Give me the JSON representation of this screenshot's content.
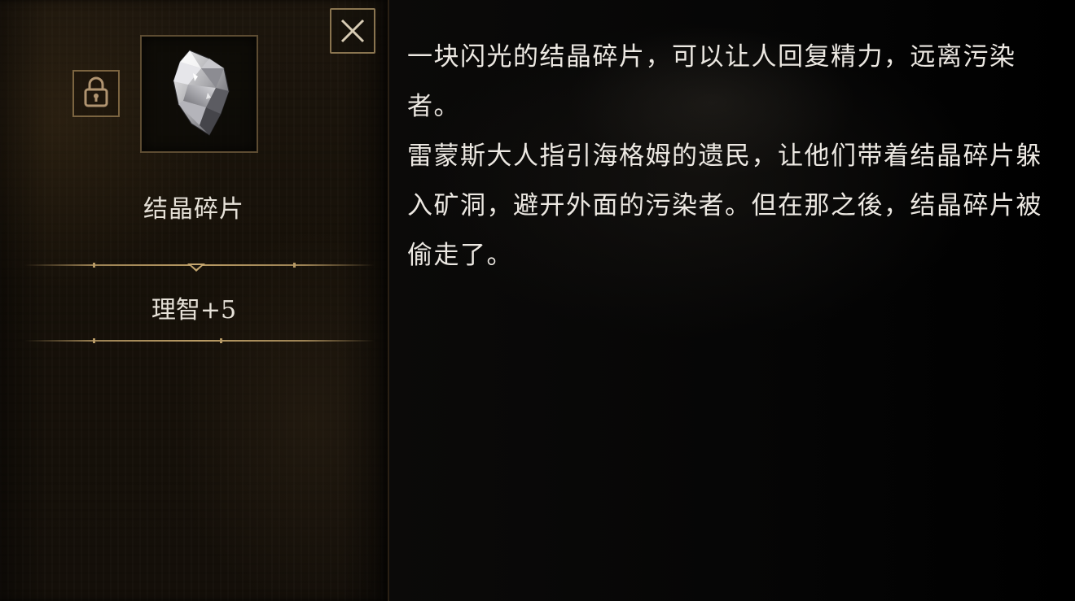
{
  "item": {
    "name": "结晶碎片",
    "stat": "理智+5",
    "icon": "crystal-shard-icon"
  },
  "controls": {
    "close_icon": "close-icon",
    "lock_icon": "lock-icon"
  },
  "description": {
    "paragraph_1": "一块闪光的结晶碎片，可以让人回复精力，远离污染者。",
    "paragraph_2": "雷蒙斯大人指引海格姆的遗民，让他们带着结晶碎片躲入矿洞，避开外面的污染者。但在那之後，结晶碎片被偷走了。"
  },
  "colors": {
    "accent_gold": "#b79a66",
    "text": "#ece8e2",
    "panel_bg": "#171109"
  }
}
